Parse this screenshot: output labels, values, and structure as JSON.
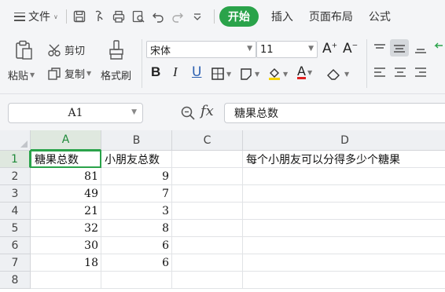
{
  "menubar": {
    "file_label": "文件",
    "tabs": [
      {
        "label": "开始",
        "active": true
      },
      {
        "label": "插入",
        "active": false
      },
      {
        "label": "页面布局",
        "active": false
      },
      {
        "label": "公式",
        "active": false
      }
    ],
    "quick_icons": [
      "save-icon",
      "format-painter-icon",
      "print-icon",
      "print-preview-icon",
      "undo-icon",
      "redo-icon",
      "customize-icon"
    ]
  },
  "ribbon": {
    "paste_label": "粘贴",
    "cut_label": "剪切",
    "copy_label": "复制",
    "format_painter_label": "格式刷",
    "font_name": "宋体",
    "font_size": "11",
    "bold": "B",
    "italic": "I",
    "underline": "U"
  },
  "formula_bar": {
    "cell_ref": "A1",
    "fx_label": "fx",
    "formula_value": "糖果总数"
  },
  "sheet": {
    "columns": [
      "A",
      "B",
      "C",
      "D"
    ],
    "selected_column": "A",
    "rows": [
      "1",
      "2",
      "3",
      "4",
      "5",
      "6",
      "7",
      "8"
    ],
    "selected_row": "1",
    "cells": [
      [
        "糖果总数",
        "小朋友总数",
        "",
        "每个小朋友可以分得多少个糖果"
      ],
      [
        "81",
        "9",
        "",
        ""
      ],
      [
        "49",
        "7",
        "",
        ""
      ],
      [
        "21",
        "3",
        "",
        ""
      ],
      [
        "32",
        "8",
        "",
        ""
      ],
      [
        "30",
        "6",
        "",
        ""
      ],
      [
        "18",
        "6",
        "",
        ""
      ],
      [
        "",
        "",
        "",
        ""
      ]
    ]
  },
  "colors": {
    "accent": "#2aa34a",
    "chrome": "#f4f5f7"
  }
}
